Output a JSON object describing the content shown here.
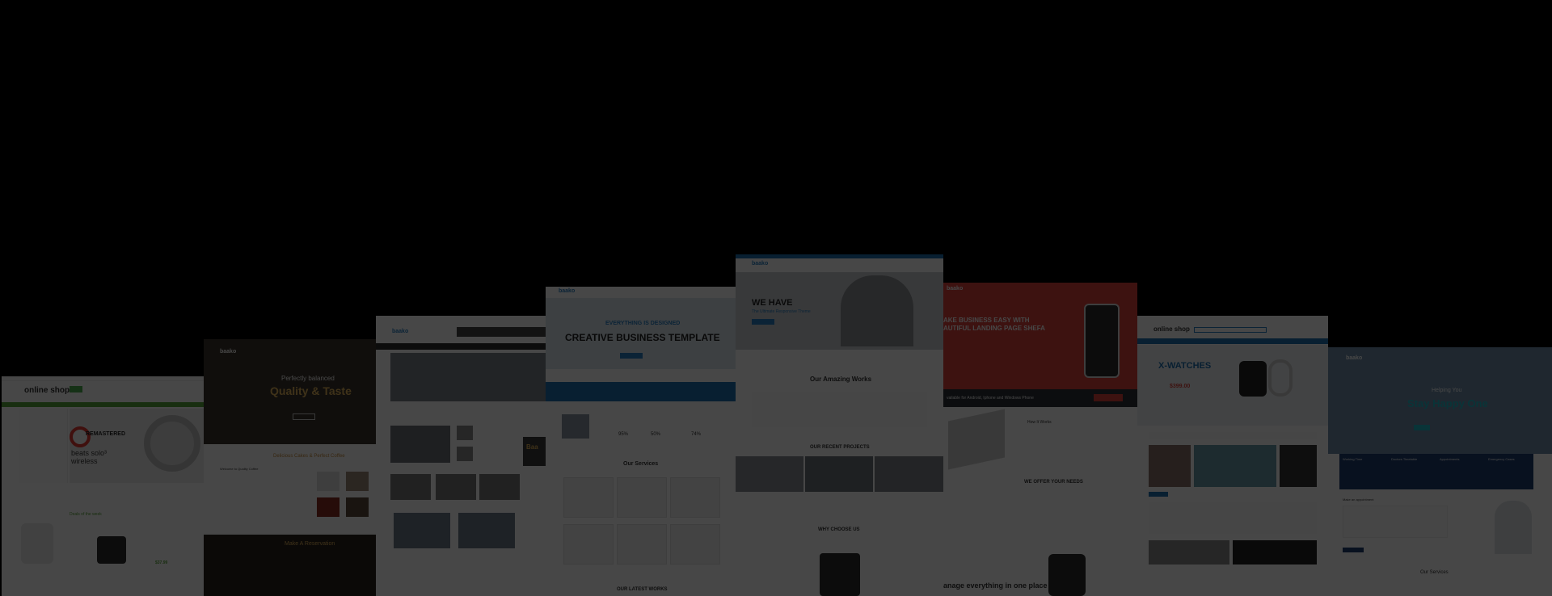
{
  "shots": {
    "online_store": {
      "logo": "online shop",
      "banner_title": "REMASTERED",
      "banner_sub": "beats solo³ wireless",
      "deal_label": "Deals of the week",
      "product_price": "$37.99"
    },
    "coffee": {
      "logo": "baako",
      "hero_line1": "Perfectly balanced",
      "hero_line2": "Quality & Taste",
      "section_title": "Delicious Cakes & Perfect Coffee",
      "welcome": "Welcome to Quality Coffee",
      "reservation": "Make A Reservation"
    },
    "news": {
      "logo": "baako",
      "brand_box": "Baa"
    },
    "business": {
      "logo": "baako",
      "hero_kicker": "EVERYTHING IS DESIGNED",
      "hero_title": "CREATIVE BUSINESS TEMPLATE",
      "services_title": "Our Services",
      "stat1": "95%",
      "stat2": "50%",
      "stat3": "74%",
      "works_title": "OUR LATEST WORKS"
    },
    "agency": {
      "logo": "baako",
      "hero_title": "WE HAVE",
      "hero_sub": "The Ultimate Responsive Theme",
      "works_title": "Our Amazing Works",
      "projects_title": "OUR RECENT PROJECTS",
      "why_title": "WHY CHOOSE US"
    },
    "app": {
      "logo": "baako",
      "hero_title": "AKE BUSINESS EASY WITH",
      "hero_title2": "AUTIFUL LANDING PAGE SHEFA",
      "available": "vailable for Android, Iphone and Windows Phone",
      "how": "How It Works",
      "needs": "WE OFFER YOUR NEEDS",
      "manage": "anage everything in one place"
    },
    "watches": {
      "logo": "online shop",
      "hero_title": "X-WATCHES",
      "hero_price": "$399.00"
    },
    "medical": {
      "logo": "baako",
      "hero_kicker": "Helping You",
      "hero_title": "Stay Happy One",
      "box1": "Working Time",
      "box2": "Doctors Timetable",
      "box3": "Appointments",
      "box4": "Emergency Cases",
      "appoint": "Make an appointment",
      "services": "Our Services"
    }
  }
}
